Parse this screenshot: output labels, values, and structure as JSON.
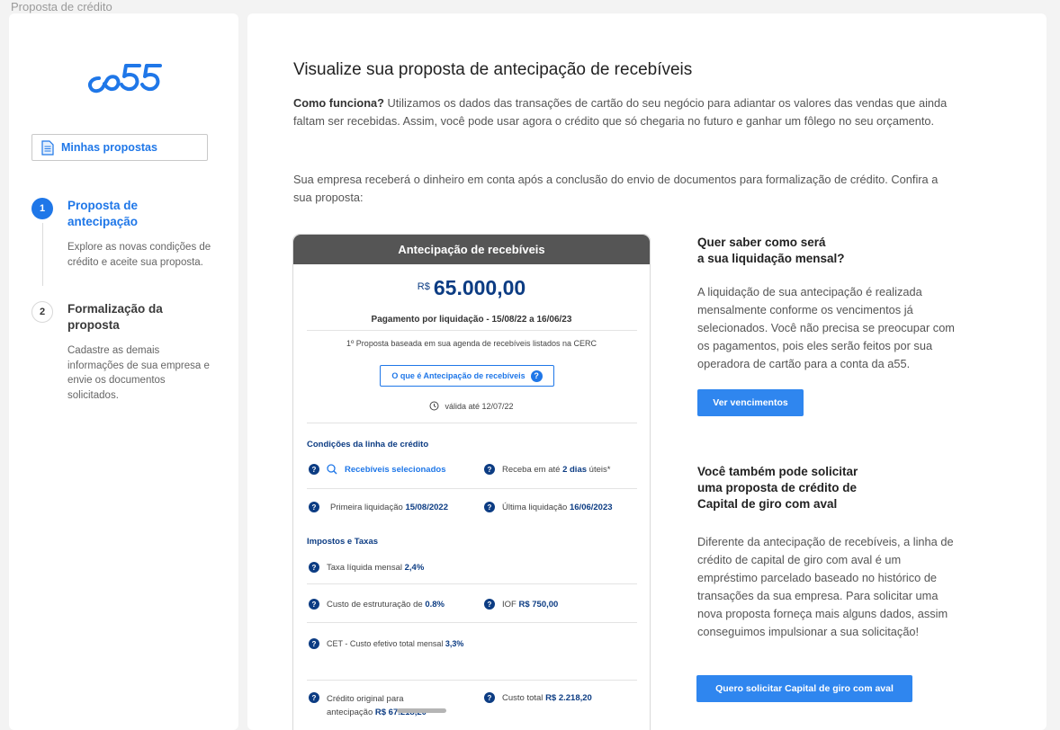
{
  "frame_title": "Proposta de crédito",
  "brand": {
    "logo_text": "a55",
    "color": "#1f77e8"
  },
  "sidebar": {
    "my_proposals_label": "Minhas propostas",
    "steps": [
      {
        "number": "1",
        "title": "Proposta de antecipação",
        "description": "Explore as novas condições de crédito e aceite sua proposta.",
        "active": true
      },
      {
        "number": "2",
        "title": "Formalização da proposta",
        "description": "Cadastre as demais informações de sua empresa e envie os documentos solicitados.",
        "active": false
      }
    ]
  },
  "main": {
    "title": "Visualize sua proposta de antecipação de recebíveis",
    "intro_bold": "Como funciona?",
    "intro_text": " Utilizamos os dados das transações de cartão do seu negócio para adiantar os valores das vendas que ainda faltam ser recebidas. Assim, você pode usar agora o crédito que só chegaria no futuro e ganhar um fôlego no seu orçamento.",
    "intro2": "Sua empresa receberá o dinheiro em conta após a conclusão do envio de documentos para formalização de crédito. Confira a sua proposta:"
  },
  "card": {
    "header": "Antecipação de recebíveis",
    "currency": "R$",
    "amount": "65.000,00",
    "payment": "Pagamento por liquidação - 15/08/22 a 16/06/23",
    "basis": "1º Proposta baseada em sua agenda de recebíveis listados na CERC",
    "what_button": "O que é Antecipação de recebíveis",
    "valid": "válida até 12/07/22",
    "conditions_title": "Condições da linha de crédito",
    "selected_receivables": "Recebíveis selecionados",
    "receive_prefix": "Receba em até ",
    "receive_days": "2 dias",
    "receive_suffix": " úteis*",
    "first_liq_label": "Primeira liquidação ",
    "first_liq_value": "15/08/2022",
    "last_liq_label": "Última liquidação ",
    "last_liq_value": "16/06/2023",
    "taxes_title": "Impostos e Taxas",
    "net_rate_label": "Taxa líquida mensal ",
    "net_rate_value": "2,4%",
    "structuring_label": "Custo de estruturação de ",
    "structuring_value": "0.8%",
    "iof_label": "IOF ",
    "iof_value": "R$ 750,00",
    "cet_label": "CET - Custo efetivo total mensal ",
    "cet_value": "3,3%",
    "original_label_1": "Crédito original para",
    "original_label_2": "antecipação ",
    "original_value": "R$ 67.218,20",
    "total_cost_label": "Custo total ",
    "total_cost_value": "R$ 2.218,20"
  },
  "right": {
    "h1_line1": "Quer saber como será",
    "h1_line2": "a sua  liquidação mensal?",
    "p1": "A liquidação de sua antecipação é realizada mensalmente conforme os vencimentos já selecionados. Você não precisa se preocupar com os pagamentos, pois eles serão feitos por sua operadora de cartão para a conta da a55.",
    "btn1": "Ver vencimentos",
    "h2_line1": "Você também pode solicitar",
    "h2_line2": "uma proposta de crédito de",
    "h2_line3": "Capital de giro com aval",
    "p2": "Diferente da antecipação de recebíveis, a linha de crédito de capital de giro com aval é um empréstimo parcelado baseado no histórico de transações da sua empresa. Para solicitar uma nova proposta forneça mais alguns dados, assim conseguimos impulsionar a sua solicitação!",
    "btn2": "Quero solicitar Capital de giro com aval"
  },
  "icons": {
    "help": "question-circle-icon",
    "search": "search-icon",
    "clock": "clock-icon",
    "document": "document-icon"
  }
}
